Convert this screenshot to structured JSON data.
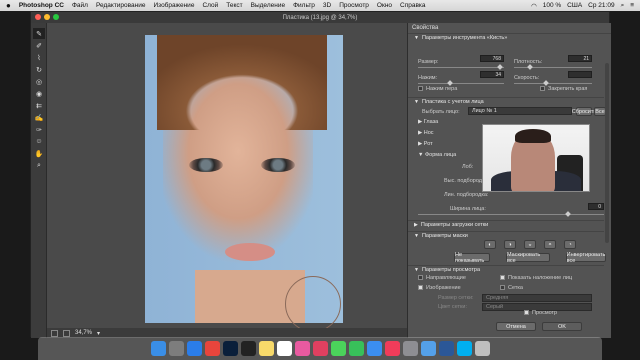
{
  "menubar": {
    "apple": "",
    "app": "Photoshop CC",
    "items": [
      "Файл",
      "Редактирование",
      "Изображение",
      "Слой",
      "Текст",
      "Выделение",
      "Фильтр",
      "3D",
      "Просмотр",
      "Окно",
      "Справка"
    ],
    "battery": "100 %",
    "flag": "США",
    "clock": "Ср 21:09"
  },
  "window": {
    "title": "Пластика (13.jpg @ 34,7%)"
  },
  "status": {
    "zoom": "34,7%"
  },
  "panel": {
    "title": "Свойства",
    "brush_section": "Параметры инструмента «Кисть»",
    "size_label": "Размер:",
    "size_value": "768",
    "density_label": "Плотность:",
    "density_value": "21",
    "pressure_label": "Нажим:",
    "pressure_value": "34",
    "rate_label": "Скорость:",
    "rate_value": "",
    "stylus_label": "Нажим пера",
    "pin_label": "Закрепить края",
    "face_section": "Пластика с учетом лица",
    "select_face_label": "Выбрать лицо:",
    "select_face_value": "Лицо № 1",
    "reset_label": "Сбросить",
    "all_label": "Все",
    "eyes_label": "Глаза",
    "nose_label": "Нос",
    "mouth_label": "Рот",
    "face_shape_label": "Форма лица",
    "forehead_label": "Лоб:",
    "chin_height_label": "Выс. подбородка:",
    "jaw_label": "Лин. подбородка:",
    "face_width_label": "Ширина лица:",
    "face_width_value": "0",
    "mesh_section": "Параметры загрузки сетки",
    "mask_section": "Параметры маски",
    "none_btn": "Не показывать",
    "mask_all_btn": "Маскировать все",
    "invert_btn": "Инвертировать все",
    "view_section": "Параметры просмотра",
    "guides_label": "Направляющие",
    "face_overlay_label": "Показать наложение лиц",
    "image_label": "Изображение",
    "mesh_label": "Сетка",
    "mesh_size_label": "Размер сетки:",
    "mesh_size_value": "Средняя",
    "mesh_color_label": "Цвет сетки:",
    "mesh_color_value": "Серый",
    "preview_label": "Просмотр",
    "cancel_btn": "Отмена",
    "ok_btn": "OK"
  },
  "dock": {
    "apps": [
      "Finder",
      "Launchpad",
      "Safari",
      "Chrome",
      "Photoshop",
      "Terminal",
      "Notes",
      "Calendar",
      "Photos",
      "iTunes",
      "Messages",
      "FaceTime",
      "App Store",
      "Music",
      "Preferences",
      "Maps",
      "Word",
      "Skype",
      "Trash"
    ]
  },
  "colors": {
    "dock_icons": [
      "#3a8ee6",
      "#7d7d7d",
      "#2b7de9",
      "#e8453c",
      "#0a1f3a",
      "#222",
      "#f7d96a",
      "#ffffff",
      "#e85aa0",
      "#e04060",
      "#4bd35b",
      "#38c05a",
      "#3b8ef0",
      "#f03c5a",
      "#8e8e93",
      "#54a0e8",
      "#2b5797",
      "#00aff0",
      "#bfbfbf"
    ]
  }
}
